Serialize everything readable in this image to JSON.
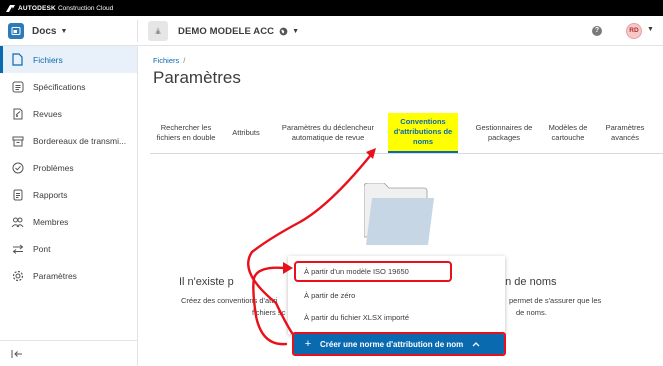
{
  "topbar": {
    "brand_strong": "AUTODESK",
    "brand_light": "Construction Cloud"
  },
  "header": {
    "product_name": "Docs",
    "project_name": "DEMO MODELE ACC",
    "user_initials": "RD"
  },
  "sidebar": {
    "items": [
      {
        "label": "Fichiers",
        "icon": "file-icon",
        "active": true
      },
      {
        "label": "Spécifications",
        "icon": "specifications-icon"
      },
      {
        "label": "Revues",
        "icon": "reviews-icon"
      },
      {
        "label": "Bordereaux de transmi...",
        "icon": "transmittals-icon"
      },
      {
        "label": "Problèmes",
        "icon": "issues-icon"
      },
      {
        "label": "Rapports",
        "icon": "reports-icon"
      },
      {
        "label": "Membres",
        "icon": "members-icon"
      },
      {
        "label": "Pont",
        "icon": "bridge-icon"
      },
      {
        "label": "Paramètres",
        "icon": "gear-icon"
      }
    ]
  },
  "main": {
    "breadcrumb": {
      "link": "Fichiers",
      "separator": "/"
    },
    "title": "Paramètres",
    "tabs": [
      {
        "label": "Rechercher les fichiers en double"
      },
      {
        "label": "Attributs"
      },
      {
        "label": "Paramètres du déclencheur automatique de revue"
      },
      {
        "label": "Conventions d'attributions de noms",
        "active": true
      },
      {
        "label": "Gestionnaires de packages"
      },
      {
        "label": "Modèles de cartouche"
      },
      {
        "label": "Paramètres avancés"
      }
    ],
    "empty_state": {
      "title_left": "Il n'existe p",
      "title_right": "on de noms",
      "desc_line1_left": "Créez des conventions d'attri",
      "desc_line1_right": "permet de s'assurer que les",
      "desc_line2_left": "fichiers sc",
      "desc_line2_right": "de noms."
    },
    "dropdown": {
      "items": [
        {
          "label": "À partir d'un modèle ISO 19650"
        },
        {
          "label": "À partir de zéro"
        },
        {
          "label": "À partir du fichier XLSX importé"
        }
      ]
    },
    "create_button": {
      "plus": "+",
      "label": "Créer une norme d'attribution de nom"
    }
  },
  "colors": {
    "accent": "#0a6ab0",
    "annotation_red": "#e8101a",
    "active_tab_highlight": "#ffff00",
    "topbar": "#000000"
  }
}
